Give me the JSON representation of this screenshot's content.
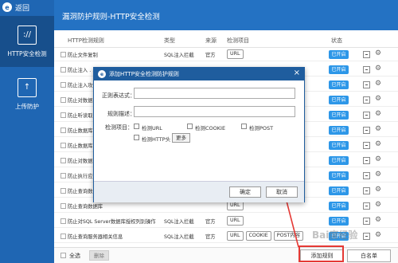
{
  "app": {
    "back_label": "返回",
    "title": "漏洞防护规则-HTTP安全检测"
  },
  "sidebar": {
    "items": [
      {
        "label": "HTTP安全检测",
        "active": true
      },
      {
        "label": "上传防护",
        "active": false
      }
    ]
  },
  "table": {
    "headers": {
      "name": "HTTP检测规则",
      "type": "类型",
      "source": "来源",
      "items": "检测项目",
      "status": "状态"
    },
    "rows": [
      {
        "name": "防止文件复制",
        "type": "SQL注入拦截",
        "source": "官方",
        "tags": [
          "URL"
        ],
        "status": "已开启"
      },
      {
        "name": "防止注入 . . .",
        "type": "",
        "source": "",
        "tags": [],
        "status": "已开启"
      },
      {
        "name": "防止注入攻",
        "type": "",
        "source": "",
        "tags": [],
        "status": "已开启"
      },
      {
        "name": "防止对数据",
        "type": "",
        "source": "",
        "tags": [],
        "status": "已开启"
      },
      {
        "name": "防止听读取",
        "type": "",
        "source": "",
        "tags": [],
        "status": "已开启"
      },
      {
        "name": "防止数据库",
        "type": "",
        "source": "",
        "tags": [],
        "status": "已开启"
      },
      {
        "name": "防止数据库",
        "type": "",
        "source": "",
        "tags": [],
        "status": "已开启"
      },
      {
        "name": "防止对数据",
        "type": "",
        "source": "",
        "tags": [],
        "status": "已开启"
      },
      {
        "name": "防止执行应",
        "type": "",
        "source": "",
        "tags": [],
        "status": "已开启"
      },
      {
        "name": "防止查询数",
        "type": "",
        "source": "",
        "tags": [],
        "status": "已开启"
      },
      {
        "name": "防止查询数据库",
        "type": "",
        "source": "",
        "tags": [
          "URL"
        ],
        "status": "已开启"
      },
      {
        "name": "防止对SQL Server数据库授权列别操作",
        "type": "SQL注入拦截",
        "source": "官方",
        "tags": [
          "URL"
        ],
        "status": "已开启"
      },
      {
        "name": "防止查询服务器相关信息",
        "type": "SQL注入拦截",
        "source": "官方",
        "tags": [
          "URL",
          "COOKIE",
          "POST内容"
        ],
        "status": "已开启"
      }
    ]
  },
  "footer": {
    "select_all": "全选",
    "delete": "删除",
    "add_rule": "添加规则",
    "whitelist": "白名单"
  },
  "modal": {
    "title": "添加HTTP安全检测防护规则",
    "regex_label": "正则表达式：",
    "desc_label": "规则描述：",
    "check_label": "检测项目：",
    "options": [
      "检测URL",
      "检测COOKIE",
      "检测POST",
      "检测HTTP头"
    ],
    "more": "更多",
    "ok": "确定",
    "cancel": "取消"
  },
  "watermark": "Bai度经验",
  "colors": {
    "sidebar": "#1f66b3",
    "header": "#2472c3",
    "status_on": "#2d97e8",
    "annotation": "#e53935"
  }
}
